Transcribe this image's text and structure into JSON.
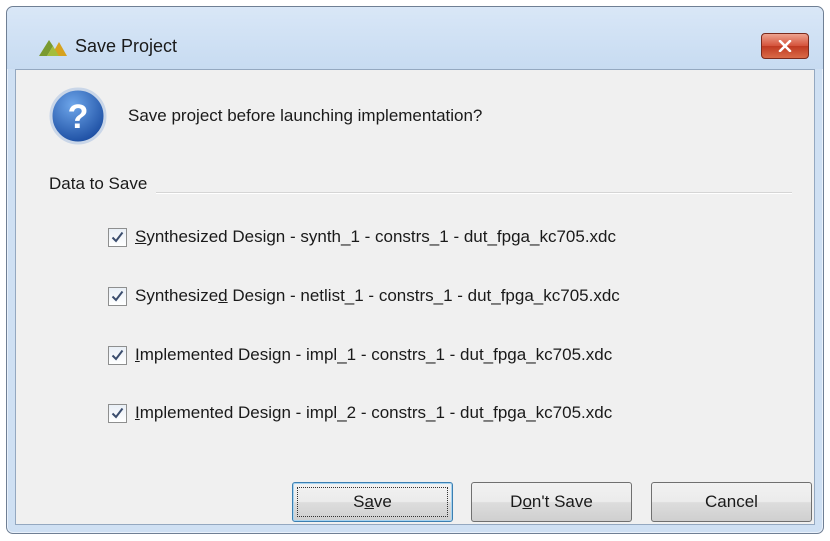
{
  "window": {
    "title": "Save Project"
  },
  "icons": {
    "app": "xilinx-logo-icon",
    "close": "close-icon",
    "question": "question-icon"
  },
  "prompt": "Save project before launching implementation?",
  "group_label": "Data to Save",
  "items": [
    {
      "mnemonic": "S",
      "rest": "ynthesized Design - synth_1 - constrs_1 - dut_fpga_kc705.xdc",
      "checked": true
    },
    {
      "pre": "Synthesize",
      "mnemonic": "d",
      "rest": " Design - netlist_1 - constrs_1 - dut_fpga_kc705.xdc",
      "checked": true
    },
    {
      "mnemonic": "I",
      "rest": "mplemented Design - impl_1 - constrs_1 - dut_fpga_kc705.xdc",
      "checked": true
    },
    {
      "mnemonic": "I",
      "rest": "mplemented Design - impl_2 - constrs_1 - dut_fpga_kc705.xdc",
      "checked": true
    }
  ],
  "buttons": {
    "save": {
      "pre": "S",
      "mnemonic": "a",
      "post": "ve"
    },
    "dont_save": {
      "pre": "D",
      "mnemonic": "o",
      "post": "n't Save"
    },
    "cancel": {
      "label": "Cancel"
    }
  },
  "colors": {
    "title_bar": "#cfe0f3",
    "close_button": "#c9452c",
    "question_badge": "#2a63b8"
  }
}
